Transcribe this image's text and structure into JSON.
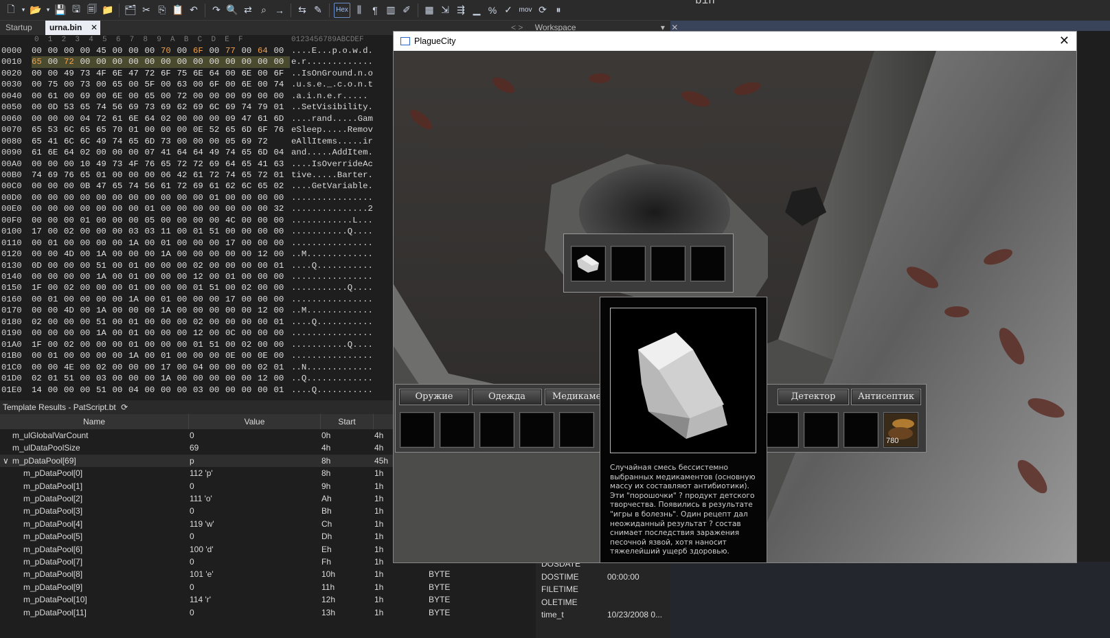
{
  "toolbar": {
    "hex_label": "Hex",
    "mov_label": "mov",
    "icons": [
      "new-file-icon",
      "dropdown-arrow-icon",
      "open-folder-icon",
      "dropdown-arrow-icon",
      "save-icon",
      "save-as-icon",
      "save-all-icon",
      "folder-icon",
      "folders-icon",
      "cut-icon",
      "copy-icon",
      "paste-icon",
      "undo-icon",
      "redo-icon",
      "find-icon",
      "replace-icon",
      "find-in-files-icon",
      "goto-icon",
      "compare-icon",
      "script-icon",
      "hex-toggle",
      "columns-icon",
      "paragraph-icon",
      "layout-icon",
      "highlight-icon",
      "calculator-icon",
      "import-icon",
      "convert-icon",
      "histogram-icon",
      "percent-icon",
      "checksum-icon",
      "mov-label",
      "refresh-icon",
      "pause-icon"
    ]
  },
  "tabs": [
    {
      "label": "Startup"
    },
    {
      "label": "urna.bin",
      "close": "✕"
    }
  ],
  "workspace": {
    "label": "Workspace",
    "nav": "< >",
    "pin": "▾",
    "close": "✕"
  },
  "top_right_fragment": "bin",
  "hex": {
    "col_header": "0  1  2  3  4  5  6  7  8  9  A  B  C  D  E  F",
    "ascii_header": "0123456789ABCDEF",
    "rows": [
      {
        "off": "0000",
        "b": [
          "00",
          "00",
          "00",
          "00",
          "45",
          "00",
          "00",
          "00",
          "70",
          "00",
          "6F",
          "00",
          "77",
          "00",
          "64",
          "00"
        ],
        "hl": [
          8,
          10,
          12,
          14
        ],
        "a": "....E...p.o.w.d."
      },
      {
        "off": "0010",
        "b": [
          "65",
          "00",
          "72",
          "00",
          "00",
          "00",
          "00",
          "00",
          "00",
          "00",
          "00",
          "00",
          "00",
          "00",
          "00",
          "00"
        ],
        "hl": [
          0,
          2
        ],
        "a": "e.r.............",
        "sel": true
      },
      {
        "off": "0020",
        "b": [
          "00",
          "00",
          "49",
          "73",
          "4F",
          "6E",
          "47",
          "72",
          "6F",
          "75",
          "6E",
          "64",
          "00",
          "6E",
          "00",
          "6F"
        ],
        "a": "..IsOnGround.n.o"
      },
      {
        "off": "0030",
        "b": [
          "00",
          "75",
          "00",
          "73",
          "00",
          "65",
          "00",
          "5F",
          "00",
          "63",
          "00",
          "6F",
          "00",
          "6E",
          "00",
          "74"
        ],
        "a": ".u.s.e._.c.o.n.t"
      },
      {
        "off": "0040",
        "b": [
          "00",
          "61",
          "00",
          "69",
          "00",
          "6E",
          "00",
          "65",
          "00",
          "72",
          "00",
          "00",
          "00",
          "09",
          "00",
          "00"
        ],
        "a": ".a.i.n.e.r....."
      },
      {
        "off": "0050",
        "b": [
          "00",
          "0D",
          "53",
          "65",
          "74",
          "56",
          "69",
          "73",
          "69",
          "62",
          "69",
          "6C",
          "69",
          "74",
          "79",
          "01"
        ],
        "a": "..SetVisibility."
      },
      {
        "off": "0060",
        "b": [
          "00",
          "00",
          "00",
          "04",
          "72",
          "61",
          "6E",
          "64",
          "02",
          "00",
          "00",
          "00",
          "09",
          "47",
          "61",
          "6D"
        ],
        "a": "....rand.....Gam"
      },
      {
        "off": "0070",
        "b": [
          "65",
          "53",
          "6C",
          "65",
          "65",
          "70",
          "01",
          "00",
          "00",
          "00",
          "0E",
          "52",
          "65",
          "6D",
          "6F",
          "76"
        ],
        "a": "eSleep.....Remov"
      },
      {
        "off": "0080",
        "b": [
          "65",
          "41",
          "6C",
          "6C",
          "49",
          "74",
          "65",
          "6D",
          "73",
          "00",
          "00",
          "00",
          "05",
          "69",
          "72"
        ],
        "a": "eAllItems.....ir"
      },
      {
        "off": "0090",
        "b": [
          "61",
          "6E",
          "64",
          "02",
          "00",
          "00",
          "00",
          "07",
          "41",
          "64",
          "64",
          "49",
          "74",
          "65",
          "6D",
          "04"
        ],
        "a": "and.....AddItem."
      },
      {
        "off": "00A0",
        "b": [
          "00",
          "00",
          "00",
          "10",
          "49",
          "73",
          "4F",
          "76",
          "65",
          "72",
          "72",
          "69",
          "64",
          "65",
          "41",
          "63"
        ],
        "a": "....IsOverrideAc"
      },
      {
        "off": "00B0",
        "b": [
          "74",
          "69",
          "76",
          "65",
          "01",
          "00",
          "00",
          "00",
          "06",
          "42",
          "61",
          "72",
          "74",
          "65",
          "72",
          "01"
        ],
        "a": "tive.....Barter."
      },
      {
        "off": "00C0",
        "b": [
          "00",
          "00",
          "00",
          "0B",
          "47",
          "65",
          "74",
          "56",
          "61",
          "72",
          "69",
          "61",
          "62",
          "6C",
          "65",
          "02"
        ],
        "a": "....GetVariable."
      },
      {
        "off": "00D0",
        "b": [
          "00",
          "00",
          "00",
          "00",
          "00",
          "00",
          "00",
          "00",
          "00",
          "00",
          "00",
          "01",
          "00",
          "00",
          "00",
          "00"
        ],
        "a": "................"
      },
      {
        "off": "00E0",
        "b": [
          "00",
          "00",
          "00",
          "00",
          "00",
          "00",
          "00",
          "01",
          "00",
          "00",
          "00",
          "00",
          "00",
          "00",
          "00",
          "32"
        ],
        "a": "...............2"
      },
      {
        "off": "00F0",
        "b": [
          "00",
          "00",
          "00",
          "01",
          "00",
          "00",
          "00",
          "05",
          "00",
          "00",
          "00",
          "00",
          "4C",
          "00",
          "00",
          "00"
        ],
        "a": "............L..."
      },
      {
        "off": "0100",
        "b": [
          "17",
          "00",
          "02",
          "00",
          "00",
          "00",
          "03",
          "03",
          "11",
          "00",
          "01",
          "51",
          "00",
          "00",
          "00",
          "00"
        ],
        "a": "...........Q...."
      },
      {
        "off": "0110",
        "b": [
          "00",
          "01",
          "00",
          "00",
          "00",
          "00",
          "1A",
          "00",
          "01",
          "00",
          "00",
          "00",
          "17",
          "00",
          "00",
          "00"
        ],
        "a": "................"
      },
      {
        "off": "0120",
        "b": [
          "00",
          "00",
          "4D",
          "00",
          "1A",
          "00",
          "00",
          "00",
          "1A",
          "00",
          "00",
          "00",
          "00",
          "00",
          "12",
          "00"
        ],
        "a": "..M............."
      },
      {
        "off": "0130",
        "b": [
          "0D",
          "00",
          "00",
          "00",
          "51",
          "00",
          "01",
          "00",
          "00",
          "00",
          "02",
          "00",
          "00",
          "00",
          "00",
          "01"
        ],
        "a": "....Q..........."
      },
      {
        "off": "0140",
        "b": [
          "00",
          "00",
          "00",
          "00",
          "1A",
          "00",
          "01",
          "00",
          "00",
          "00",
          "12",
          "00",
          "01",
          "00",
          "00",
          "00"
        ],
        "a": "................"
      },
      {
        "off": "0150",
        "b": [
          "1F",
          "00",
          "02",
          "00",
          "00",
          "00",
          "01",
          "00",
          "00",
          "00",
          "01",
          "51",
          "00",
          "02",
          "00",
          "00"
        ],
        "a": "...........Q...."
      },
      {
        "off": "0160",
        "b": [
          "00",
          "01",
          "00",
          "00",
          "00",
          "00",
          "1A",
          "00",
          "01",
          "00",
          "00",
          "00",
          "17",
          "00",
          "00",
          "00"
        ],
        "a": "................"
      },
      {
        "off": "0170",
        "b": [
          "00",
          "00",
          "4D",
          "00",
          "1A",
          "00",
          "00",
          "00",
          "1A",
          "00",
          "00",
          "00",
          "00",
          "00",
          "12",
          "00"
        ],
        "a": "..M............."
      },
      {
        "off": "0180",
        "b": [
          "02",
          "00",
          "00",
          "00",
          "51",
          "00",
          "01",
          "00",
          "00",
          "00",
          "02",
          "00",
          "00",
          "00",
          "00",
          "01"
        ],
        "a": "....Q..........."
      },
      {
        "off": "0190",
        "b": [
          "00",
          "00",
          "00",
          "00",
          "1A",
          "00",
          "01",
          "00",
          "00",
          "00",
          "12",
          "00",
          "0C",
          "00",
          "00",
          "00"
        ],
        "a": "................"
      },
      {
        "off": "01A0",
        "b": [
          "1F",
          "00",
          "02",
          "00",
          "00",
          "00",
          "01",
          "00",
          "00",
          "00",
          "01",
          "51",
          "00",
          "02",
          "00",
          "00"
        ],
        "a": "...........Q...."
      },
      {
        "off": "01B0",
        "b": [
          "00",
          "01",
          "00",
          "00",
          "00",
          "00",
          "1A",
          "00",
          "01",
          "00",
          "00",
          "00",
          "0E",
          "00",
          "0E",
          "00"
        ],
        "a": "................"
      },
      {
        "off": "01C0",
        "b": [
          "00",
          "00",
          "4E",
          "00",
          "02",
          "00",
          "00",
          "00",
          "17",
          "00",
          "04",
          "00",
          "00",
          "00",
          "02",
          "01"
        ],
        "a": "..N............."
      },
      {
        "off": "01D0",
        "b": [
          "02",
          "01",
          "51",
          "00",
          "03",
          "00",
          "00",
          "00",
          "1A",
          "00",
          "00",
          "00",
          "00",
          "00",
          "12",
          "00"
        ],
        "a": "..Q............."
      },
      {
        "off": "01E0",
        "b": [
          "14",
          "00",
          "00",
          "00",
          "51",
          "00",
          "04",
          "00",
          "00",
          "00",
          "03",
          "00",
          "00",
          "00",
          "00",
          "01"
        ],
        "a": "....Q..........."
      }
    ]
  },
  "template": {
    "header": "Template Results - PatScript.bt",
    "refresh_icon": "⟳",
    "columns": [
      "Name",
      "Value",
      "Start"
    ],
    "rows": [
      {
        "name": "m_ulGlobalVarCount",
        "value": "0",
        "start": "0h",
        "size": "4h",
        "type": "",
        "indent": 1
      },
      {
        "name": "m_ulDataPoolSize",
        "value": "69",
        "start": "4h",
        "size": "4h",
        "type": "",
        "indent": 1
      },
      {
        "name": "m_pDataPool[69]",
        "value": "p",
        "start": "8h",
        "size": "45h",
        "type": "",
        "indent": 0,
        "expanded": true,
        "arrow": "∨"
      },
      {
        "name": "m_pDataPool[0]",
        "value": "112 'p'",
        "start": "8h",
        "size": "1h",
        "type": "",
        "indent": 2
      },
      {
        "name": "m_pDataPool[1]",
        "value": "0",
        "start": "9h",
        "size": "1h",
        "type": "",
        "indent": 2
      },
      {
        "name": "m_pDataPool[2]",
        "value": "111 'o'",
        "start": "Ah",
        "size": "1h",
        "type": "",
        "indent": 2
      },
      {
        "name": "m_pDataPool[3]",
        "value": "0",
        "start": "Bh",
        "size": "1h",
        "type": "",
        "indent": 2
      },
      {
        "name": "m_pDataPool[4]",
        "value": "119 'w'",
        "start": "Ch",
        "size": "1h",
        "type": "",
        "indent": 2
      },
      {
        "name": "m_pDataPool[5]",
        "value": "0",
        "start": "Dh",
        "size": "1h",
        "type": "",
        "indent": 2
      },
      {
        "name": "m_pDataPool[6]",
        "value": "100 'd'",
        "start": "Eh",
        "size": "1h",
        "type": "",
        "indent": 2
      },
      {
        "name": "m_pDataPool[7]",
        "value": "0",
        "start": "Fh",
        "size": "1h",
        "type": "",
        "indent": 2
      },
      {
        "name": "m_pDataPool[8]",
        "value": "101 'e'",
        "start": "10h",
        "size": "1h",
        "type": "BYTE",
        "indent": 2
      },
      {
        "name": "m_pDataPool[9]",
        "value": "0",
        "start": "11h",
        "size": "1h",
        "type": "BYTE",
        "indent": 2
      },
      {
        "name": "m_pDataPool[10]",
        "value": "114 'r'",
        "start": "12h",
        "size": "1h",
        "type": "BYTE",
        "indent": 2
      },
      {
        "name": "m_pDataPool[11]",
        "value": "0",
        "start": "13h",
        "size": "1h",
        "type": "BYTE",
        "indent": 2
      }
    ]
  },
  "date_panel": {
    "rows": [
      {
        "label": "DOSDATE",
        "value": ""
      },
      {
        "label": "DOSTIME",
        "value": "00:00:00"
      },
      {
        "label": "FILETIME",
        "value": ""
      },
      {
        "label": "OLETIME",
        "value": ""
      },
      {
        "label": "time_t",
        "value": "10/23/2008 0..."
      }
    ]
  },
  "game": {
    "title": "PlagueCity",
    "close": "✕",
    "tabs_left": [
      "Оружие",
      "Одежда",
      "Медикамен"
    ],
    "tabs_right": [
      "Детектор",
      "Антисептик"
    ],
    "item_count": "780",
    "tooltip_text": "Случайная смесь бессистемно выбранных медикаментов (основную массу их составляют антибиотики). Эти \"порошочки\" ? продукт детского творчества. Появились в результате \"игры в болезнь\". Один рецепт дал неожиданный результат ? состав снимает последствия заражения песочной язвой, хотя наносит тяжелейший ущерб здоровью."
  }
}
